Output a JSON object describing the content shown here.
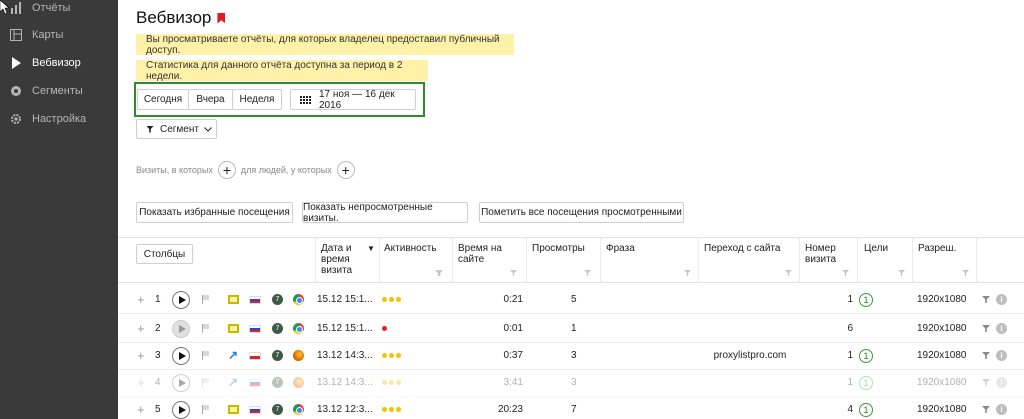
{
  "sidebar": {
    "items": [
      {
        "label": "Отчёты",
        "icon": "bar-chart-icon",
        "active": false
      },
      {
        "label": "Карты",
        "icon": "map-icon",
        "active": false
      },
      {
        "label": "Вебвизор",
        "icon": "play-icon",
        "active": true
      },
      {
        "label": "Сегменты",
        "icon": "segments-icon",
        "active": false
      },
      {
        "label": "Настройка",
        "icon": "gear-icon",
        "active": false
      }
    ]
  },
  "page": {
    "title": "Вебвизор",
    "notice_public": "Вы просматриваете отчёты, для которых владелец предоставил публичный доступ.",
    "notice_period": "Статистика для данного отчёта доступна за период в 2 недели."
  },
  "period": {
    "today": "Сегодня",
    "yesterday": "Вчера",
    "week": "Неделя",
    "date_range": "17 ноя — 16 дек 2016"
  },
  "segment": {
    "label": "Сегмент"
  },
  "filters": {
    "visits_where": "Визиты, в которых",
    "people_where": "для людей, у которых"
  },
  "actions": {
    "show_favorites": "Показать избранные посещения",
    "show_unviewed": "Показать непросмотренные визиты.",
    "mark_all_viewed": "Пометить все посещения просмотренными"
  },
  "table": {
    "columns_button": "Столбцы",
    "headers": {
      "date": "Дата и время визита",
      "activity": "Активность",
      "time": "Время на сайте",
      "views": "Просмотры",
      "phrase": "Фраза",
      "referrer": "Переход с сайта",
      "visit_no": "Номер визита",
      "goals": "Цели",
      "resolution": "Разреш."
    },
    "rows": [
      {
        "n": "1",
        "date": "15.12 15:1...",
        "time": "0:21",
        "views": "5",
        "referrer": "",
        "visit_no": "1",
        "goal": "1",
        "resolution": "1920x1080"
      },
      {
        "n": "2",
        "date": "15.12 15:1...",
        "time": "0:01",
        "views": "1",
        "referrer": "",
        "visit_no": "6",
        "goal": "",
        "resolution": "1920x1080"
      },
      {
        "n": "3",
        "date": "13.12 14:3...",
        "time": "0:37",
        "views": "3",
        "referrer": "proxylistpro.com",
        "visit_no": "1",
        "goal": "1",
        "resolution": "1920x1080"
      },
      {
        "n": "4",
        "date": "13.12 14:3...",
        "time": "3:41",
        "views": "3",
        "referrer": "",
        "visit_no": "1",
        "goal": "1",
        "resolution": "1920x1080"
      },
      {
        "n": "5",
        "date": "13.12 12:3...",
        "time": "20:23",
        "views": "7",
        "referrer": "",
        "visit_no": "4",
        "goal": "1",
        "resolution": "1920x1080"
      }
    ]
  },
  "colors": {
    "sidebar": "#3a3a3a",
    "notice": "#fff1a8",
    "highlight": "#2e8b2e",
    "brand_red": "#e11c24"
  }
}
